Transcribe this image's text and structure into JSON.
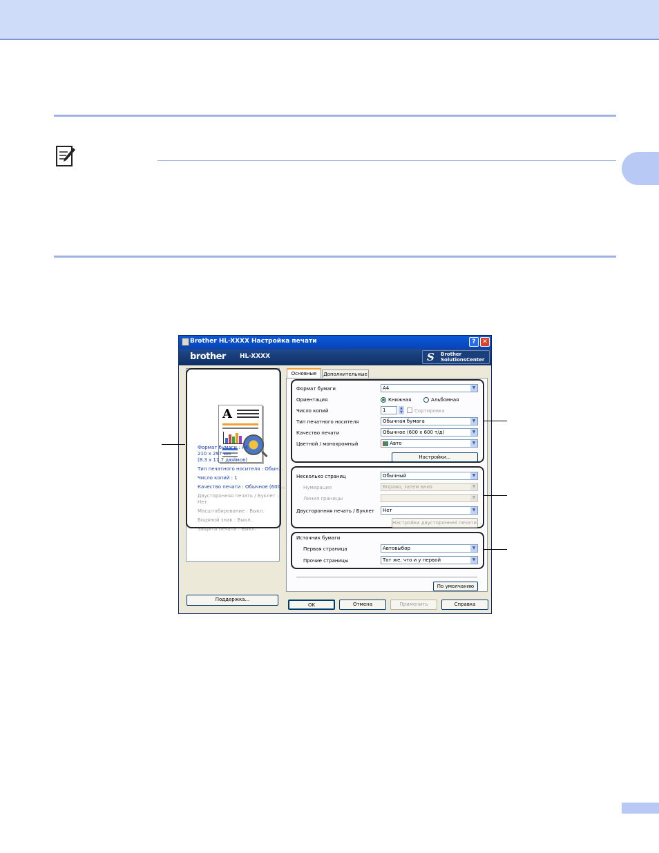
{
  "dialog": {
    "title": "Brother HL-XXXX Настройка печати",
    "help_glyph": "?",
    "close_glyph": "✕",
    "brand_logo": "brother",
    "brand_model": "HL-XXXX",
    "solutions_line1": "Brother",
    "solutions_line2": "SolutionsCenter",
    "solutions_glyph": "S"
  },
  "tabs": [
    {
      "label": "Основные",
      "active": true
    },
    {
      "label": "Дополнительные",
      "active": false
    }
  ],
  "preview_info": {
    "paper_format": "Формат бумаги : А4",
    "size_mm": "210 x 297 мм",
    "size_in": "(8.3 x 11.7 дюймов)",
    "media_type": "Тип печатного носителя : Обын...",
    "copies": "Число копий : 1",
    "quality": "Качество печати : Обычное (600...",
    "duplex": "Двусторонняя печать / Буклет :",
    "duplex_value": "Нет",
    "scaling": "Масштабирование : Выкл.",
    "watermark": "Водяной знак : Выкл.",
    "protect": "Защита печати : Выкл."
  },
  "form": {
    "paper_format_label": "Формат бумаги",
    "paper_format_value": "A4",
    "orientation_label": "Ориентация",
    "portrait_label": "Книжная",
    "landscape_label": "Альбомная",
    "copies_label": "Число копий",
    "copies_value": "1",
    "collate_label": "Сортировка",
    "media_label": "Тип печатного носителя",
    "media_value": "Обычная бумага",
    "quality_label": "Качество печати",
    "quality_value": "Обычное (600 x 600 т/д)",
    "color_label": "Цветной / монохромный",
    "color_value": "Авто",
    "settings_button": "Настройки...",
    "multipage_label": "Несколько страниц",
    "multipage_value": "Обычный",
    "order_label": "Нумерация",
    "order_value": "Вправо, затем вниз",
    "border_label": "Линия границы",
    "border_value": "",
    "duplex_label": "Двусторонняя печать / Буклет",
    "duplex_value": "Нет",
    "duplex_settings_button": "Настройки двусторонней печати...",
    "source_title": "Источник бумаги",
    "first_page_label": "Первая страница",
    "first_page_value": "Автовыбор",
    "other_pages_label": "Прочие страницы",
    "other_pages_value": "Тот же, что и у первой",
    "default_button": "По умолчанию"
  },
  "buttons": {
    "support": "Поддержка...",
    "ok": "OK",
    "cancel": "Отмена",
    "apply": "Применить",
    "help": "Справка"
  },
  "icons": {
    "note": "note-pencil-icon",
    "printer_app": "printer-app-icon",
    "color_mode": "color-mode-icon"
  },
  "colors": {
    "header_band": "#cfdcf9",
    "rule": "#9fb2e8",
    "titlebar": "#0a5ad8",
    "brandbar": "#1f4a8a"
  }
}
